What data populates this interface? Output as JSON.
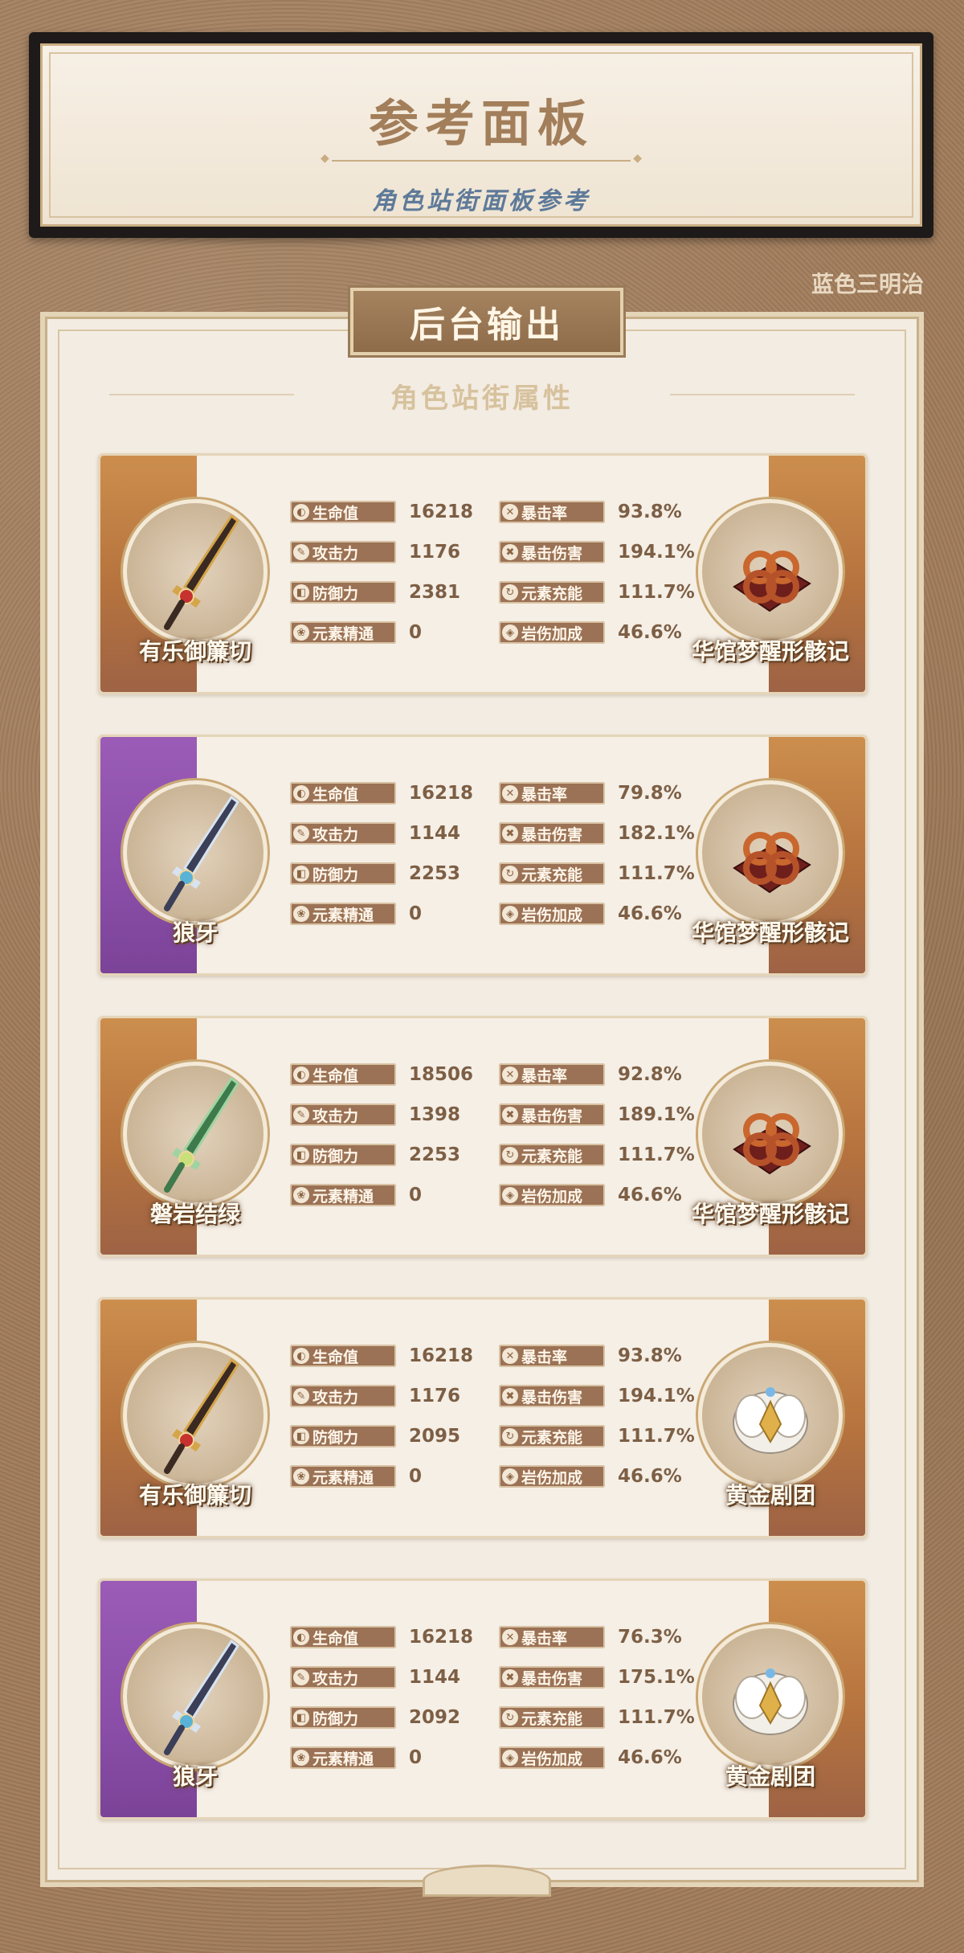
{
  "header": {
    "title": "参考面板",
    "subtitle": "角色站街面板参考"
  },
  "author": "蓝色三明治",
  "section": {
    "banner": "后台输出",
    "subheading": "角色站街属性"
  },
  "stat_labels": {
    "hp": "生命值",
    "atk": "攻击力",
    "def": "防御力",
    "em": "元素精通",
    "crit_rate": "暴击率",
    "crit_dmg": "暴击伤害",
    "er": "元素充能",
    "geo_dmg": "岩伤加成"
  },
  "stat_icons": {
    "hp": "hp-droplet-icon",
    "atk": "sword-icon",
    "def": "shield-icon",
    "em": "elemental-mastery-icon",
    "crit_rate": "crit-rate-icon",
    "crit_dmg": "crit-damage-icon",
    "er": "energy-recharge-icon",
    "geo_dmg": "geo-damage-icon"
  },
  "colors": {
    "orange_side": "#c07f46",
    "purple_side": "#8e52ab",
    "tag_bg": "#9b7255",
    "value_text": "#7d5f45",
    "subtitle_blue": "#5e7a99"
  },
  "builds": [
    {
      "weapon": "有乐御簾切",
      "weapon_rarity_color": "orange",
      "artifact": "华馆梦醒形骸记",
      "hp": "16218",
      "atk": "1176",
      "def": "2381",
      "em": "0",
      "crit_rate": "93.8%",
      "crit_dmg": "194.1%",
      "er": "111.7%",
      "geo_dmg": "46.6%"
    },
    {
      "weapon": "狼牙",
      "weapon_rarity_color": "purple",
      "artifact": "华馆梦醒形骸记",
      "hp": "16218",
      "atk": "1144",
      "def": "2253",
      "em": "0",
      "crit_rate": "79.8%",
      "crit_dmg": "182.1%",
      "er": "111.7%",
      "geo_dmg": "46.6%"
    },
    {
      "weapon": "磐岩结绿",
      "weapon_rarity_color": "orange",
      "artifact": "华馆梦醒形骸记",
      "hp": "18506",
      "atk": "1398",
      "def": "2253",
      "em": "0",
      "crit_rate": "92.8%",
      "crit_dmg": "189.1%",
      "er": "111.7%",
      "geo_dmg": "46.6%"
    },
    {
      "weapon": "有乐御簾切",
      "weapon_rarity_color": "orange",
      "artifact": "黄金剧团",
      "hp": "16218",
      "atk": "1176",
      "def": "2095",
      "em": "0",
      "crit_rate": "93.8%",
      "crit_dmg": "194.1%",
      "er": "111.7%",
      "geo_dmg": "46.6%"
    },
    {
      "weapon": "狼牙",
      "weapon_rarity_color": "purple",
      "artifact": "黄金剧团",
      "hp": "16218",
      "atk": "1144",
      "def": "2092",
      "em": "0",
      "crit_rate": "76.3%",
      "crit_dmg": "175.1%",
      "er": "111.7%",
      "geo_dmg": "46.6%"
    }
  ]
}
